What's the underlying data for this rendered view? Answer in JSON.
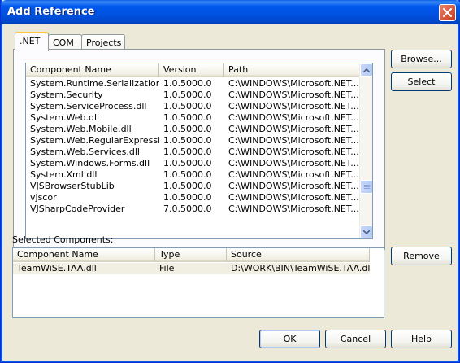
{
  "window": {
    "title": "Add Reference"
  },
  "tabs": [
    {
      "label": ".NET",
      "active": true
    },
    {
      "label": "COM",
      "active": false
    },
    {
      "label": "Projects",
      "active": false
    }
  ],
  "components_list": {
    "columns": [
      "Component Name",
      "Version",
      "Path"
    ],
    "rows": [
      [
        "System.Runtime.Serialization....",
        "1.0.5000.0",
        "C:\\WINDOWS\\Microsoft.NET..."
      ],
      [
        "System.Security",
        "1.0.5000.0",
        "C:\\WINDOWS\\Microsoft.NET..."
      ],
      [
        "System.ServiceProcess.dll",
        "1.0.5000.0",
        "C:\\WINDOWS\\Microsoft.NET..."
      ],
      [
        "System.Web.dll",
        "1.0.5000.0",
        "C:\\WINDOWS\\Microsoft.NET..."
      ],
      [
        "System.Web.Mobile.dll",
        "1.0.5000.0",
        "C:\\WINDOWS\\Microsoft.NET..."
      ],
      [
        "System.Web.RegularExpressi...",
        "1.0.5000.0",
        "C:\\WINDOWS\\Microsoft.NET..."
      ],
      [
        "System.Web.Services.dll",
        "1.0.5000.0",
        "C:\\WINDOWS\\Microsoft.NET..."
      ],
      [
        "System.Windows.Forms.dll",
        "1.0.5000.0",
        "C:\\WINDOWS\\Microsoft.NET..."
      ],
      [
        "System.Xml.dll",
        "1.0.5000.0",
        "C:\\WINDOWS\\Microsoft.NET..."
      ],
      [
        "VJSBrowserStubLib",
        "1.0.5000.0",
        "C:\\WINDOWS\\Microsoft.NET..."
      ],
      [
        "vjscor",
        "1.0.5000.0",
        "C:\\WINDOWS\\Microsoft.NET..."
      ],
      [
        "VJSharpCodeProvider",
        "7.0.5000.0",
        "C:\\WINDOWS\\Microsoft.NET..."
      ]
    ]
  },
  "side_buttons": {
    "browse": "Browse...",
    "select": "Select"
  },
  "selected_components": {
    "label": "Selected Components:",
    "columns": [
      "Component Name",
      "Type",
      "Source"
    ],
    "rows": [
      [
        "TeamWiSE.TAA.dll",
        "File",
        "D:\\WORK\\BIN\\TeamWiSE.TAA.dll"
      ]
    ],
    "remove_label": "Remove"
  },
  "footer": {
    "ok": "OK",
    "cancel": "Cancel",
    "help": "Help"
  },
  "icons": {
    "close": "close-icon",
    "scroll_up": "chevron-up-icon",
    "scroll_down": "chevron-down-icon"
  }
}
